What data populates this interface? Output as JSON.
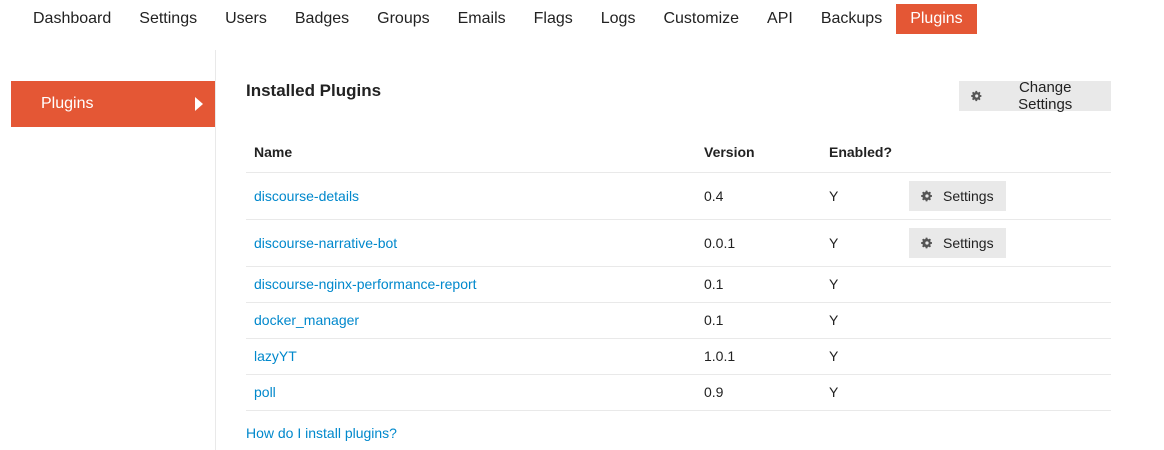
{
  "nav": {
    "tabs": [
      {
        "label": "Dashboard",
        "active": false
      },
      {
        "label": "Settings",
        "active": false
      },
      {
        "label": "Users",
        "active": false
      },
      {
        "label": "Badges",
        "active": false
      },
      {
        "label": "Groups",
        "active": false
      },
      {
        "label": "Emails",
        "active": false
      },
      {
        "label": "Flags",
        "active": false
      },
      {
        "label": "Logs",
        "active": false
      },
      {
        "label": "Customize",
        "active": false
      },
      {
        "label": "API",
        "active": false
      },
      {
        "label": "Backups",
        "active": false
      },
      {
        "label": "Plugins",
        "active": true
      }
    ]
  },
  "sidebar": {
    "items": [
      {
        "label": "Plugins",
        "icon": "chevron-right-icon"
      }
    ]
  },
  "main": {
    "heading": "Installed Plugins",
    "change_settings_label": "Change Settings",
    "table": {
      "columns": [
        "Name",
        "Version",
        "Enabled?"
      ],
      "rows": [
        {
          "name": "discourse-details",
          "version": "0.4",
          "enabled": "Y",
          "settings_label": "Settings"
        },
        {
          "name": "discourse-narrative-bot",
          "version": "0.0.1",
          "enabled": "Y",
          "settings_label": "Settings"
        },
        {
          "name": "discourse-nginx-performance-report",
          "version": "0.1",
          "enabled": "Y"
        },
        {
          "name": "docker_manager",
          "version": "0.1",
          "enabled": "Y"
        },
        {
          "name": "lazyYT",
          "version": "1.0.1",
          "enabled": "Y"
        },
        {
          "name": "poll",
          "version": "0.9",
          "enabled": "Y"
        }
      ]
    },
    "help_link": "How do I install plugins?"
  },
  "colors": {
    "accent": "#e45735",
    "link": "#0088cc",
    "button_bg": "#e9e9e9",
    "divider": "#e9e9e9"
  }
}
